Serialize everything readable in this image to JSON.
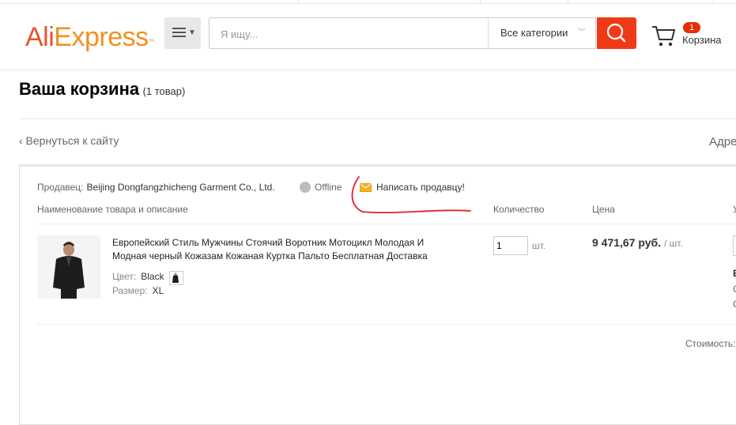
{
  "header": {
    "logo_ali": "AliExpress",
    "search_placeholder": "Я ищу...",
    "category_label": "Все категории",
    "cart_count": "1",
    "cart_label": "Корзина"
  },
  "page": {
    "title": "Ваша корзина",
    "item_count": "(1 товар)",
    "back_link": "‹ Вернуться к сайту",
    "right_cut": "Адре"
  },
  "seller": {
    "label": "Продавец:",
    "name": "Beijing Dongfangzhicheng Garment Co., Ltd.",
    "status": "Offline",
    "message_link": "Написать продавцу!"
  },
  "columns": {
    "name": "Наименование товара и описание",
    "quantity": "Количество",
    "price": "Цена"
  },
  "item": {
    "title": "Европейский Стиль Мужчины Стоячий Воротник Мотоцикл Молодая И Модная черный Кожазам Кожаная Куртка Пальто Бесплатная Доставка",
    "color_label": "Цвет:",
    "color_value": "Black",
    "size_label": "Размер:",
    "size_value": "XL",
    "quantity": "1",
    "unit": "шт.",
    "price": "9 471,67 руб.",
    "per_unit": "/ шт."
  },
  "footer": {
    "cost_label": "Стоимость:"
  },
  "colors": {
    "brand_red": "#f03a17",
    "logo_orange": "#f29021",
    "annotation_red": "#e8202a"
  }
}
